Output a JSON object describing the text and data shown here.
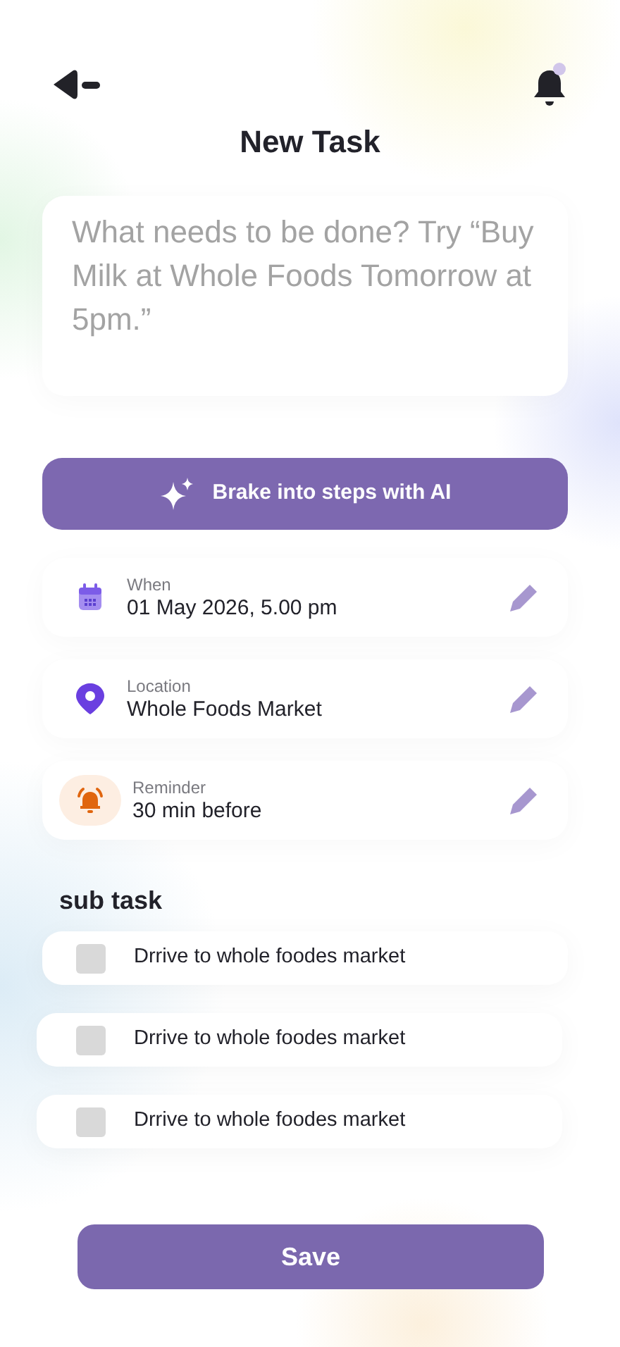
{
  "header": {
    "title": "New Task"
  },
  "task_input": {
    "placeholder": "What needs to be done? Try “Buy Milk at Whole Foods Tomorrow at 5pm.”"
  },
  "ai_button": {
    "label": "Brake into steps with AI"
  },
  "details": [
    {
      "kind": "date",
      "label": "When",
      "value": "01 May 2026, 5.00 pm"
    },
    {
      "kind": "location",
      "label": "Location",
      "value": "Whole Foods Market"
    },
    {
      "kind": "reminder",
      "label": "Reminder",
      "value": "30 min before"
    }
  ],
  "subtasks": {
    "title": "sub task",
    "items": [
      {
        "text": "Drrive to whole foodes market",
        "checked": false
      },
      {
        "text": "Drrive to whole foodes market",
        "checked": false
      },
      {
        "text": "Drrive to whole foodes market",
        "checked": false
      }
    ]
  },
  "save_button": {
    "label": "Save"
  }
}
